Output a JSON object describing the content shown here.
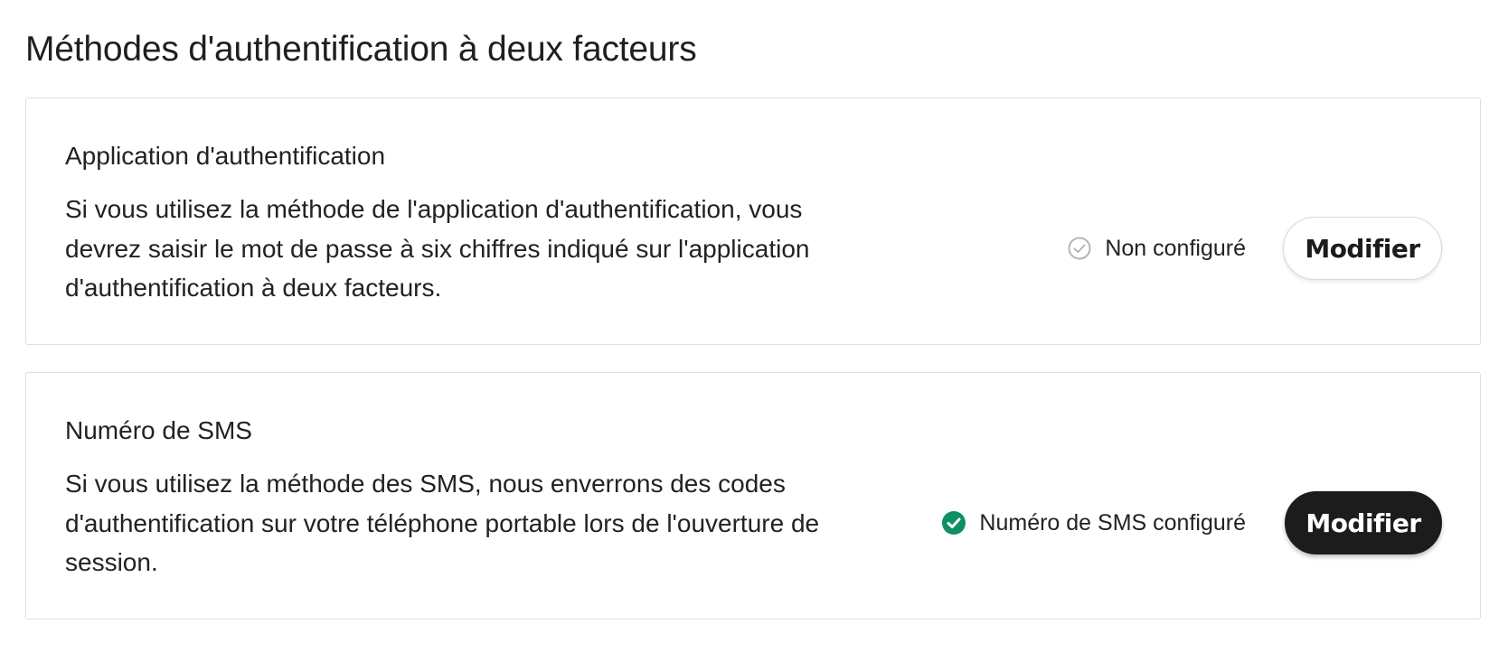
{
  "page": {
    "title": "Méthodes d'authentification à deux facteurs"
  },
  "methods": [
    {
      "title": "Application d'authentification",
      "description": "Si vous utilisez la méthode de l'application d'authentification, vous devrez saisir le mot de passe à six chiffres indiqué sur l'application d'authentification à deux facteurs.",
      "status_icon": "check-circle-outline-icon",
      "status_text": "Non configuré",
      "status_color": "#b5b5b5",
      "button_label": "Modifier",
      "button_style": "outline"
    },
    {
      "title": "Numéro de SMS",
      "description": "Si vous utilisez la méthode des SMS, nous enverrons des codes d'authentification sur votre téléphone portable lors de l'ouverture de session.",
      "status_icon": "check-circle-filled-icon",
      "status_text": "Numéro de SMS configuré",
      "status_color": "#0f8f66",
      "button_label": "Modifier",
      "button_style": "solid"
    }
  ]
}
